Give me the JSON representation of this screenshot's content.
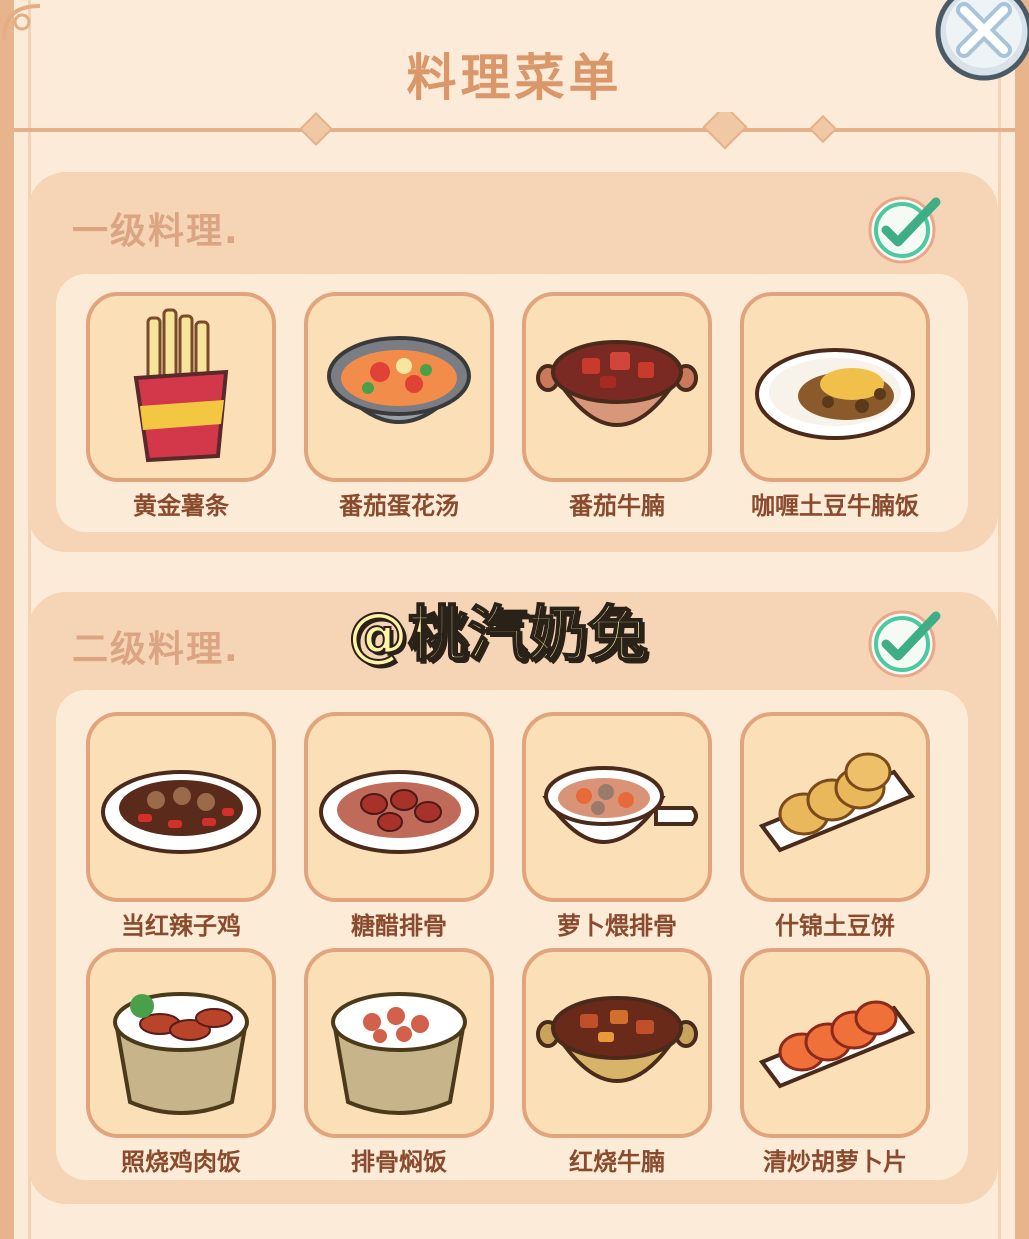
{
  "title": "料理菜单",
  "close_icon": "close-x-icon",
  "watermark": "@桃汽奶兔",
  "sections": [
    {
      "label": "一级料理.",
      "completed": true,
      "items": [
        {
          "name": "黄金薯条",
          "icon": "french-fries-icon"
        },
        {
          "name": "番茄蛋花汤",
          "icon": "tomato-egg-soup-icon"
        },
        {
          "name": "番茄牛腩",
          "icon": "tomato-beef-brisket-icon"
        },
        {
          "name": "咖喱土豆牛腩饭",
          "icon": "curry-rice-icon"
        }
      ]
    },
    {
      "label": "二级料理.",
      "completed": true,
      "items": [
        {
          "name": "当红辣子鸡",
          "icon": "spicy-chicken-icon"
        },
        {
          "name": "糖醋排骨",
          "icon": "sweet-sour-ribs-icon"
        },
        {
          "name": "萝卜煨排骨",
          "icon": "radish-ribs-pan-icon"
        },
        {
          "name": "什锦土豆饼",
          "icon": "potato-pancake-icon"
        },
        {
          "name": "照烧鸡肉饭",
          "icon": "teriyaki-chicken-rice-icon"
        },
        {
          "name": "排骨焖饭",
          "icon": "rib-rice-icon"
        },
        {
          "name": "红烧牛腩",
          "icon": "braised-beef-icon"
        },
        {
          "name": "清炒胡萝卜片",
          "icon": "carrot-slices-icon"
        }
      ]
    }
  ],
  "colors": {
    "title": "#d9976a",
    "label": "#8a4a2e",
    "panel": "#f6d5b6",
    "card": "#fbdfb7",
    "check": "#4cc9a0"
  }
}
